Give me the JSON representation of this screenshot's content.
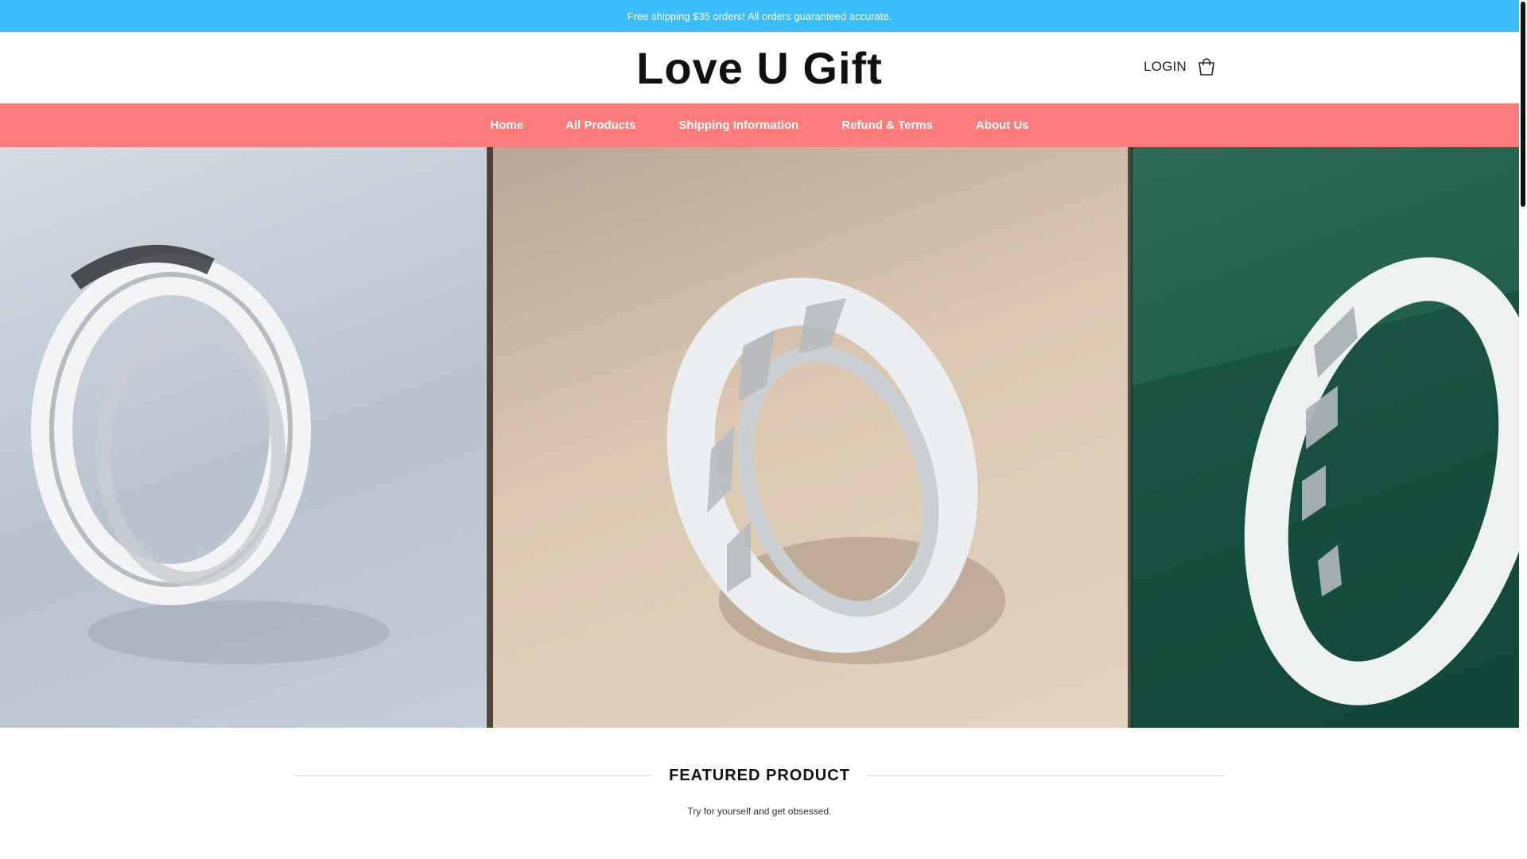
{
  "announcement": "Free shipping $35 orders! All orders guaranteed accurate.",
  "brand": {
    "logo_text": "Love U Gift"
  },
  "header": {
    "login_label": "LOGIN",
    "cart_icon": "cart-icon"
  },
  "nav": {
    "items": [
      {
        "label": "Home"
      },
      {
        "label": "All Products"
      },
      {
        "label": "Shipping Information"
      },
      {
        "label": "Refund & Terms"
      },
      {
        "label": "About Us"
      }
    ]
  },
  "hero": {
    "images": [
      "plain-silver-ring-image",
      "textured-silver-ring-image",
      "silver-ring-on-green-image"
    ]
  },
  "featured": {
    "title": "FEATURED PRODUCT",
    "subtitle": "Try for yourself and get obsessed."
  },
  "colors": {
    "announcement_bg": "#38bdf8",
    "nav_bg": "#fd7b7b"
  }
}
